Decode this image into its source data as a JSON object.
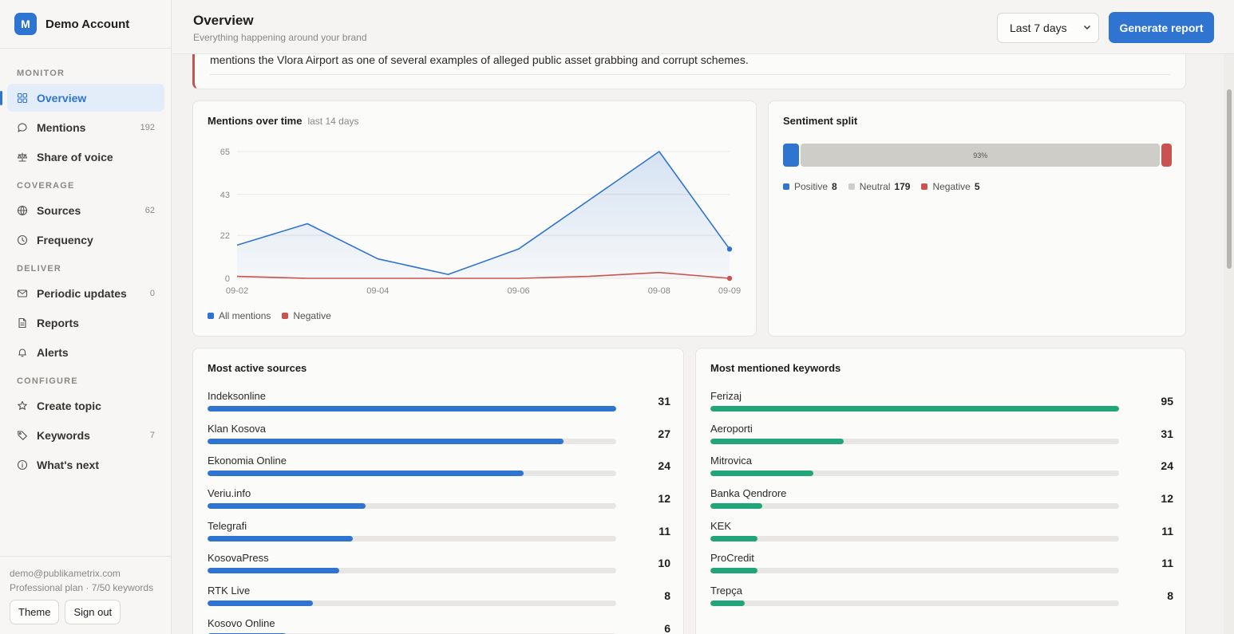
{
  "account": {
    "avatar_letter": "M",
    "name": "Demo Account"
  },
  "sidebar": {
    "sections": [
      {
        "title": "MONITOR",
        "items": [
          {
            "label": "Overview",
            "icon": "grid-icon",
            "badge": "",
            "active": true
          },
          {
            "label": "Mentions",
            "icon": "chat-bubble-icon",
            "badge": "192"
          },
          {
            "label": "Share of voice",
            "icon": "scale-icon",
            "badge": ""
          }
        ]
      },
      {
        "title": "COVERAGE",
        "items": [
          {
            "label": "Sources",
            "icon": "globe-icon",
            "badge": "62"
          },
          {
            "label": "Frequency",
            "icon": "clock-icon",
            "badge": ""
          }
        ]
      },
      {
        "title": "DELIVER",
        "items": [
          {
            "label": "Periodic updates",
            "icon": "mail-icon",
            "badge": "0"
          },
          {
            "label": "Reports",
            "icon": "document-icon",
            "badge": ""
          },
          {
            "label": "Alerts",
            "icon": "bell-icon",
            "badge": ""
          }
        ]
      },
      {
        "title": "CONFIGURE",
        "items": [
          {
            "label": "Create topic",
            "icon": "star-icon",
            "badge": ""
          },
          {
            "label": "Keywords",
            "icon": "tag-icon",
            "badge": "7"
          },
          {
            "label": "What's next",
            "icon": "info-icon",
            "badge": ""
          }
        ]
      }
    ],
    "footer": {
      "email": "demo@publikametrix.com",
      "plan": "Professional plan · 7/50 keywords",
      "theme_label": "Theme",
      "signout_label": "Sign out"
    }
  },
  "header": {
    "title": "Overview",
    "subtitle": "Everything happening around your brand",
    "range_value": "Last 7 days",
    "generate_label": "Generate report"
  },
  "alert": {
    "text": "mentions the Vlora Airport as one of several examples of alleged public asset grabbing and corrupt schemes."
  },
  "mentions_chart": {
    "title": "Mentions over time",
    "subtitle": "last 14 days"
  },
  "chart_data": {
    "type": "area",
    "x": [
      "09-02",
      "09-03",
      "09-04",
      "09-05",
      "09-06",
      "09-07",
      "09-08",
      "09-09"
    ],
    "x_tick_labels": [
      "09-02",
      "09-04",
      "09-06",
      "09-08",
      "09-09"
    ],
    "y_ticks": [
      "0",
      "22",
      "43",
      "65"
    ],
    "ylim": [
      0,
      65
    ],
    "series": [
      {
        "name": "All mentions",
        "values": [
          17,
          28,
          10,
          2,
          15,
          40,
          65,
          15
        ],
        "color": "#2f74d0"
      },
      {
        "name": "Negative",
        "values": [
          1,
          0,
          0,
          0,
          0,
          1,
          3,
          0
        ],
        "color": "#c9534f"
      }
    ],
    "grid": true,
    "legend": "bottom-left"
  },
  "sentiment": {
    "title": "Sentiment split",
    "segments": [
      {
        "label": "Positive",
        "count": "8",
        "value": 8,
        "color": "#2f74d0",
        "pct_label": ""
      },
      {
        "label": "Neutral",
        "count": "179",
        "value": 179,
        "color": "#cfcdc8",
        "pct_label": "93%"
      },
      {
        "label": "Negative",
        "count": "5",
        "value": 5,
        "color": "#c9534f",
        "pct_label": ""
      }
    ]
  },
  "sources": {
    "title": "Most active sources",
    "color": "#2f74d0",
    "max": 31,
    "rows": [
      {
        "label": "Indeksonline",
        "value": 31
      },
      {
        "label": "Klan Kosova",
        "value": 27
      },
      {
        "label": "Ekonomia Online",
        "value": 24
      },
      {
        "label": "Veriu.info",
        "value": 12
      },
      {
        "label": "Telegrafi",
        "value": 11
      },
      {
        "label": "KosovaPress",
        "value": 10
      },
      {
        "label": "RTK Live",
        "value": 8
      },
      {
        "label": "Kosovo Online",
        "value": 6
      }
    ]
  },
  "keywords": {
    "title": "Most mentioned keywords",
    "color": "#22a57a",
    "max": 95,
    "rows": [
      {
        "label": "Ferizaj",
        "value": 95
      },
      {
        "label": "Aeroporti",
        "value": 31
      },
      {
        "label": "Mitrovica",
        "value": 24
      },
      {
        "label": "Banka Qendrore",
        "value": 12
      },
      {
        "label": "KEK",
        "value": 11
      },
      {
        "label": "ProCredit",
        "value": 11
      },
      {
        "label": "Trepça",
        "value": 8
      }
    ]
  }
}
